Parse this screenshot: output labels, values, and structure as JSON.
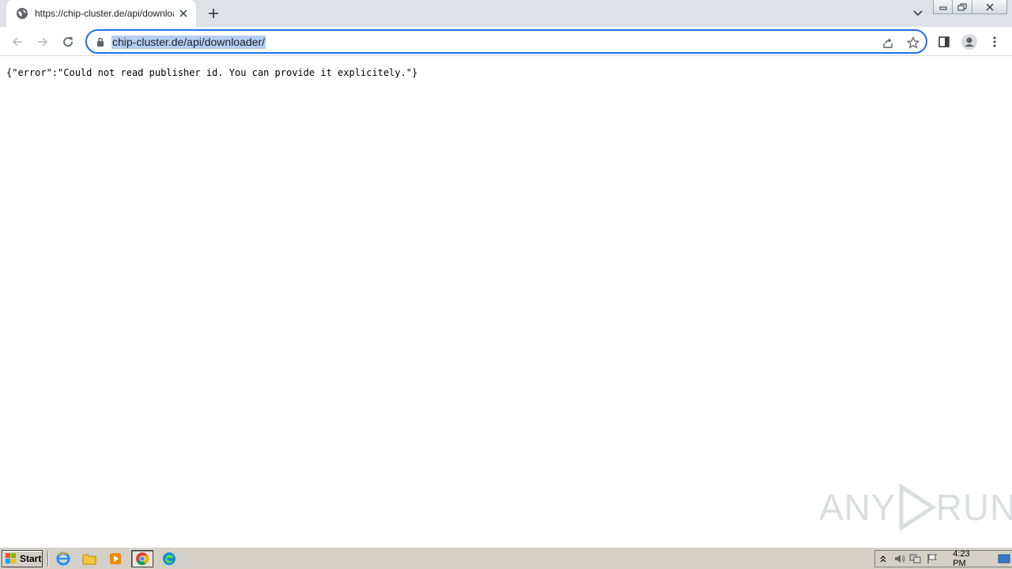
{
  "browser": {
    "tab": {
      "title": "https://chip-cluster.de/api/downloader/"
    },
    "address_bar": {
      "url": "chip-cluster.de/api/downloader/"
    }
  },
  "page": {
    "body_text": "{\"error\":\"Could not read publisher id. You can provide it explicitely.\"}"
  },
  "watermark": {
    "text_left": "ANY",
    "text_right": "RUN"
  },
  "taskbar": {
    "start_label": "Start",
    "clock": "4:23 PM"
  },
  "colors": {
    "accent": "#1a73e8",
    "selection": "#b3cff4",
    "titlebar": "#dee1e6",
    "taskbar": "#d4d0c8"
  }
}
